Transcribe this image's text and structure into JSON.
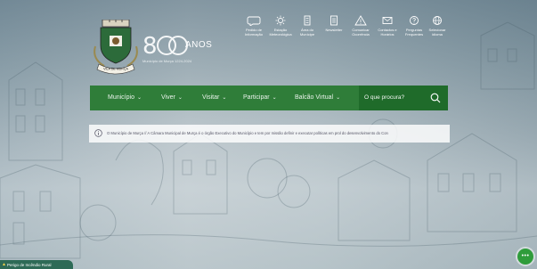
{
  "header": {
    "anniversary_title": "8",
    "anniversary_suffix": "ANOS",
    "anniversary_subtitle": "Município de Murça 1224-2024",
    "logo_banner_text": "VILA DE MURÇA"
  },
  "quicklinks": [
    {
      "label": "Pedido de Informação",
      "icon": "chat-bubble-icon"
    },
    {
      "label": "Estação Meteorológica",
      "icon": "sun-icon"
    },
    {
      "label": "Área do Munícipe",
      "icon": "building-icon"
    },
    {
      "label": "Newsletter",
      "icon": "newsletter-icon"
    },
    {
      "label": "Comunicar Ocorrência",
      "icon": "warning-icon"
    },
    {
      "label": "Contactos e Horários",
      "icon": "mail-icon"
    },
    {
      "label": "Perguntas Frequentes",
      "icon": "question-icon"
    },
    {
      "label": "Selecionar idioma",
      "icon": "globe-icon"
    }
  ],
  "nav": {
    "items": [
      {
        "label": "Município"
      },
      {
        "label": "Viver"
      },
      {
        "label": "Visitar"
      },
      {
        "label": "Participar"
      },
      {
        "label": "Balcão Virtual"
      }
    ],
    "search_placeholder": "O que procura?",
    "colors": {
      "bar": "#2f7d39",
      "search": "#1f6b2a"
    }
  },
  "info": {
    "text": "O Município de Murça // A Câmara Municipal de Murça é o órgão Executivo do Município e tem por missão definir e executar políticas em prol do desenvolvimento do Con"
  },
  "footer": {
    "alert_label": "Perigo de Incêndio Rural",
    "chat_icon": "chat-icon"
  }
}
